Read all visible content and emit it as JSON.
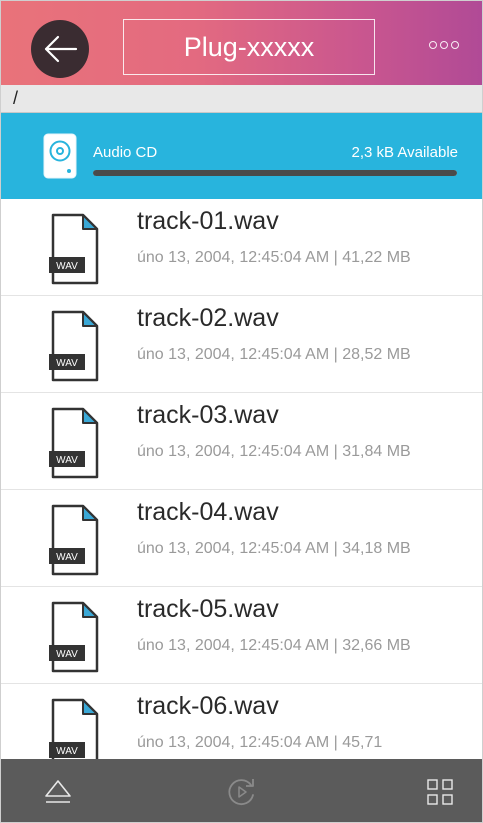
{
  "header": {
    "title": "Plug-xxxxx",
    "back_icon": "arrow-left-icon",
    "menu_icon": "more-dots-icon"
  },
  "path": {
    "current": "/"
  },
  "device": {
    "name": "Audio CD",
    "available": "2,3 kB Available",
    "icon": "disc-drive-icon",
    "used_fraction": 1.0
  },
  "files": [
    {
      "name": "track-01.wav",
      "meta": "úno 13, 2004, 12:45:04 AM | 41,22 MB",
      "badge": "WAV"
    },
    {
      "name": "track-02.wav",
      "meta": "úno 13, 2004, 12:45:04 AM | 28,52 MB",
      "badge": "WAV"
    },
    {
      "name": "track-03.wav",
      "meta": "úno 13, 2004, 12:45:04 AM | 31,84 MB",
      "badge": "WAV"
    },
    {
      "name": "track-04.wav",
      "meta": "úno 13, 2004, 12:45:04 AM | 34,18 MB",
      "badge": "WAV"
    },
    {
      "name": "track-05.wav",
      "meta": "úno 13, 2004, 12:45:04 AM | 32,66 MB",
      "badge": "WAV"
    },
    {
      "name": "track-06.wav",
      "meta": "úno 13, 2004, 12:45:04 AM | 45,71",
      "badge": "WAV"
    }
  ],
  "bottombar": {
    "eject_icon": "eject-icon",
    "refresh_icon": "refresh-icon",
    "grid_icon": "grid-view-icon"
  },
  "colors": {
    "header_gradient_start": "#e9737a",
    "header_gradient_end": "#b04a96",
    "device_bar": "#28b4dd",
    "bottom_bar": "#5b5b5b"
  }
}
